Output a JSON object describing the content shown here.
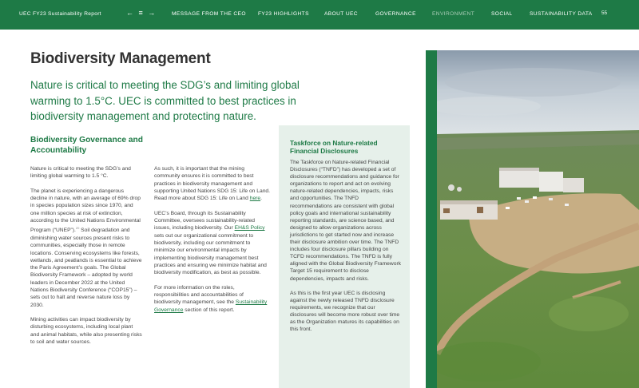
{
  "header": {
    "report_title": "UEC FY23 Sustainability Report",
    "nav_controls": "← ≡ →",
    "nav": [
      {
        "label": "MESSAGE FROM THE CEO",
        "active": false
      },
      {
        "label": "FY23 HIGHLIGHTS",
        "active": false
      },
      {
        "label": "ABOUT UEC",
        "active": false
      },
      {
        "label": "GOVERNANCE",
        "active": false
      },
      {
        "label": "ENVIRONMENT",
        "active": true
      },
      {
        "label": "SOCIAL",
        "active": false
      },
      {
        "label": "SUSTAINABILITY DATA",
        "active": false
      }
    ],
    "page_number": "55"
  },
  "page": {
    "title": "Biodiversity Management",
    "intro": "Nature is critical to meeting the SDG’s and limiting global warming to 1.5°C. UEC is committed to best practices in biodiversity management and protecting nature."
  },
  "section": {
    "heading": "Biodiversity Governance and Accountability",
    "col1": {
      "p1": "Nature is critical to meeting the SDG’s and limiting global warming to 1.5 °C.",
      "p2": "The planet is experiencing a dangerous decline in nature, with an average of 69% drop in species population sizes since 1970, and one million species at risk of extinction, according to the United Nations Environmental Program (“UNEP”).",
      "p2_ref": "20",
      "p2b": " Soil degradation and diminishing water sources present risks to communities, especially those in remote locations. Conserving ecosystems like forests, wetlands, and peatlands is essential to achieve the Paris Agreement’s goals. The Global Biodiversity Framework – adopted by world leaders in December 2022 at the United Nations Biodiversity Conference (“COP15”) – sets out to halt and reverse nature loss by 2030.",
      "p3": "Mining activities can impact biodiversity by disturbing ecosystems, including local plant and animal habitats, while also presenting risks to soil and water sources."
    },
    "col2": {
      "p1": "As such, it is important that the mining community ensures it is committed to best practices in biodiversity management and supporting United Nations SDG 15: Life on Land. Read more about SDG 15: Life on Land ",
      "p1_link": "here",
      "p1_end": ".",
      "p2": "UEC’s Board, through its Sustainability Committee, oversees sustainability-related issues, including biodiversity. Our ",
      "p2_link": "EH&S Policy",
      "p2_rest": " sets out our organizational commitment to biodiversity, including our commitment to minimize our environmental impacts by implementing biodiversity management best practices and ensuring we minimize habitat and biodiversity modification, as best as possible.",
      "p3": "For more information on the roles, responsibilities and accountabilities of biodiversity management, see the ",
      "p3_link": "Sustainability Governance",
      "p3_end": " section of this report."
    }
  },
  "panel": {
    "heading": "Taskforce on Nature-related Financial Disclosures",
    "p1": "The Taskforce on Nature-related Financial Disclosures (“TNFD”) has developed a set of disclosure recommendations and guidance for organizations to report and act on evolving nature-related dependencies, impacts, risks and opportunities. The TNFD recommendations are consistent with global policy goals and international sustainability reporting standards, are science based, and designed to allow organizations across jurisdictions to get started now and increase their disclosure ambition over time. The TNFD includes four disclosure pillars building on TCFD recommendations. The TNFD is fully aligned with the Global Biodiversity Framework Target 15 requirement to disclose dependencies, impacts and risks.",
    "p2": "As this is the first year UEC is disclosing against the newly released TNFD disclosure requirements, we recognize that our disclosures will become more robust over time as the Organization matures its capabilities on this front."
  },
  "colors": {
    "brand_green": "#1e7a46",
    "panel_bg": "#e6f0ea"
  }
}
